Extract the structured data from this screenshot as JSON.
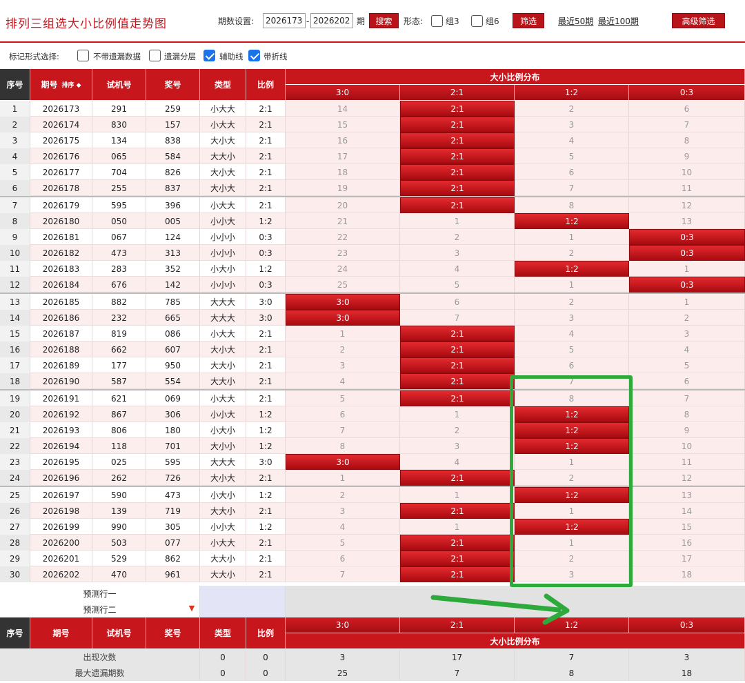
{
  "header": {
    "title": "排列三组选大小比例值走势图",
    "period_label": "期数设置:",
    "period_from": "2026173",
    "dash": "-",
    "period_to": "2026202",
    "period_unit": "期",
    "search_btn": "搜索",
    "form_label": "形态:",
    "opt_z3": "组3",
    "opt_z6": "组6",
    "filter_btn": "筛选",
    "recent50": "最近50期",
    "recent100": "最近100期",
    "advanced_btn": "高级筛选"
  },
  "marks": {
    "label": "标记形式选择:",
    "opt1": "不带遗漏数据",
    "opt2": "遗漏分层",
    "opt3": "辅助线",
    "opt4": "带折线"
  },
  "columns": {
    "seq": "序号",
    "period": "期号",
    "sort": "排序",
    "trial": "试机号",
    "award": "奖号",
    "type": "类型",
    "ratio": "比例",
    "dist_title": "大小比例分布",
    "dist": [
      "3:0",
      "2:1",
      "1:2",
      "0:3"
    ]
  },
  "rows": [
    {
      "seq": "1",
      "period": "2026173",
      "trial": "291",
      "award": "259",
      "type": "小大大",
      "ratio": "2:1",
      "dist": [
        "14",
        "2:1",
        "2",
        "6"
      ],
      "hit": 1
    },
    {
      "seq": "2",
      "period": "2026174",
      "trial": "830",
      "award": "157",
      "type": "小大大",
      "ratio": "2:1",
      "dist": [
        "15",
        "2:1",
        "3",
        "7"
      ],
      "hit": 1
    },
    {
      "seq": "3",
      "period": "2026175",
      "trial": "134",
      "award": "838",
      "type": "大小大",
      "ratio": "2:1",
      "dist": [
        "16",
        "2:1",
        "4",
        "8"
      ],
      "hit": 1
    },
    {
      "seq": "4",
      "period": "2026176",
      "trial": "065",
      "award": "584",
      "type": "大大小",
      "ratio": "2:1",
      "dist": [
        "17",
        "2:1",
        "5",
        "9"
      ],
      "hit": 1
    },
    {
      "seq": "5",
      "period": "2026177",
      "trial": "704",
      "award": "826",
      "type": "大小大",
      "ratio": "2:1",
      "dist": [
        "18",
        "2:1",
        "6",
        "10"
      ],
      "hit": 1
    },
    {
      "seq": "6",
      "period": "2026178",
      "trial": "255",
      "award": "837",
      "type": "大小大",
      "ratio": "2:1",
      "dist": [
        "19",
        "2:1",
        "7",
        "11"
      ],
      "hit": 1
    },
    {
      "seq": "7",
      "period": "2026179",
      "trial": "595",
      "award": "396",
      "type": "小大大",
      "ratio": "2:1",
      "dist": [
        "20",
        "2:1",
        "8",
        "12"
      ],
      "hit": 1
    },
    {
      "seq": "8",
      "period": "2026180",
      "trial": "050",
      "award": "005",
      "type": "小小大",
      "ratio": "1:2",
      "dist": [
        "21",
        "1",
        "1:2",
        "13"
      ],
      "hit": 2
    },
    {
      "seq": "9",
      "period": "2026181",
      "trial": "067",
      "award": "124",
      "type": "小小小",
      "ratio": "0:3",
      "dist": [
        "22",
        "2",
        "1",
        "0:3"
      ],
      "hit": 3
    },
    {
      "seq": "10",
      "period": "2026182",
      "trial": "473",
      "award": "313",
      "type": "小小小",
      "ratio": "0:3",
      "dist": [
        "23",
        "3",
        "2",
        "0:3"
      ],
      "hit": 3
    },
    {
      "seq": "11",
      "period": "2026183",
      "trial": "283",
      "award": "352",
      "type": "小大小",
      "ratio": "1:2",
      "dist": [
        "24",
        "4",
        "1:2",
        "1"
      ],
      "hit": 2
    },
    {
      "seq": "12",
      "period": "2026184",
      "trial": "676",
      "award": "142",
      "type": "小小小",
      "ratio": "0:3",
      "dist": [
        "25",
        "5",
        "1",
        "0:3"
      ],
      "hit": 3
    },
    {
      "seq": "13",
      "period": "2026185",
      "trial": "882",
      "award": "785",
      "type": "大大大",
      "ratio": "3:0",
      "dist": [
        "3:0",
        "6",
        "2",
        "1"
      ],
      "hit": 0
    },
    {
      "seq": "14",
      "period": "2026186",
      "trial": "232",
      "award": "665",
      "type": "大大大",
      "ratio": "3:0",
      "dist": [
        "3:0",
        "7",
        "3",
        "2"
      ],
      "hit": 0
    },
    {
      "seq": "15",
      "period": "2026187",
      "trial": "819",
      "award": "086",
      "type": "小大大",
      "ratio": "2:1",
      "dist": [
        "1",
        "2:1",
        "4",
        "3"
      ],
      "hit": 1
    },
    {
      "seq": "16",
      "period": "2026188",
      "trial": "662",
      "award": "607",
      "type": "大小大",
      "ratio": "2:1",
      "dist": [
        "2",
        "2:1",
        "5",
        "4"
      ],
      "hit": 1
    },
    {
      "seq": "17",
      "period": "2026189",
      "trial": "177",
      "award": "950",
      "type": "大大小",
      "ratio": "2:1",
      "dist": [
        "3",
        "2:1",
        "6",
        "5"
      ],
      "hit": 1
    },
    {
      "seq": "18",
      "period": "2026190",
      "trial": "587",
      "award": "554",
      "type": "大大小",
      "ratio": "2:1",
      "dist": [
        "4",
        "2:1",
        "7",
        "6"
      ],
      "hit": 1
    },
    {
      "seq": "19",
      "period": "2026191",
      "trial": "621",
      "award": "069",
      "type": "小大大",
      "ratio": "2:1",
      "dist": [
        "5",
        "2:1",
        "8",
        "7"
      ],
      "hit": 1
    },
    {
      "seq": "20",
      "period": "2026192",
      "trial": "867",
      "award": "306",
      "type": "小小大",
      "ratio": "1:2",
      "dist": [
        "6",
        "1",
        "1:2",
        "8"
      ],
      "hit": 2
    },
    {
      "seq": "21",
      "period": "2026193",
      "trial": "806",
      "award": "180",
      "type": "小大小",
      "ratio": "1:2",
      "dist": [
        "7",
        "2",
        "1:2",
        "9"
      ],
      "hit": 2
    },
    {
      "seq": "22",
      "period": "2026194",
      "trial": "118",
      "award": "701",
      "type": "大小小",
      "ratio": "1:2",
      "dist": [
        "8",
        "3",
        "1:2",
        "10"
      ],
      "hit": 2
    },
    {
      "seq": "23",
      "period": "2026195",
      "trial": "025",
      "award": "595",
      "type": "大大大",
      "ratio": "3:0",
      "dist": [
        "3:0",
        "4",
        "1",
        "11"
      ],
      "hit": 0
    },
    {
      "seq": "24",
      "period": "2026196",
      "trial": "262",
      "award": "726",
      "type": "大小大",
      "ratio": "2:1",
      "dist": [
        "1",
        "2:1",
        "2",
        "12"
      ],
      "hit": 1
    },
    {
      "seq": "25",
      "period": "2026197",
      "trial": "590",
      "award": "473",
      "type": "小大小",
      "ratio": "1:2",
      "dist": [
        "2",
        "1",
        "1:2",
        "13"
      ],
      "hit": 2
    },
    {
      "seq": "26",
      "period": "2026198",
      "trial": "139",
      "award": "719",
      "type": "大大小",
      "ratio": "2:1",
      "dist": [
        "3",
        "2:1",
        "1",
        "14"
      ],
      "hit": 1
    },
    {
      "seq": "27",
      "period": "2026199",
      "trial": "990",
      "award": "305",
      "type": "小小大",
      "ratio": "1:2",
      "dist": [
        "4",
        "1",
        "1:2",
        "15"
      ],
      "hit": 2
    },
    {
      "seq": "28",
      "period": "2026200",
      "trial": "503",
      "award": "077",
      "type": "小大大",
      "ratio": "2:1",
      "dist": [
        "5",
        "2:1",
        "1",
        "16"
      ],
      "hit": 1
    },
    {
      "seq": "29",
      "period": "2026201",
      "trial": "529",
      "award": "862",
      "type": "大大小",
      "ratio": "2:1",
      "dist": [
        "6",
        "2:1",
        "2",
        "17"
      ],
      "hit": 1
    },
    {
      "seq": "30",
      "period": "2026202",
      "trial": "470",
      "award": "961",
      "type": "大大小",
      "ratio": "2:1",
      "dist": [
        "7",
        "2:1",
        "3",
        "18"
      ],
      "hit": 1
    }
  ],
  "predict": {
    "row1": "预测行一",
    "row2": "预测行二"
  },
  "stats": [
    {
      "label": "出现次数",
      "type": "0",
      "ratio": "0",
      "dist": [
        "3",
        "17",
        "7",
        "3"
      ]
    },
    {
      "label": "最大遗漏期数",
      "type": "0",
      "ratio": "0",
      "dist": [
        "25",
        "7",
        "8",
        "18"
      ]
    }
  ],
  "colors": {
    "accent": "#c8161d",
    "highlight": "#2eaa3d"
  }
}
